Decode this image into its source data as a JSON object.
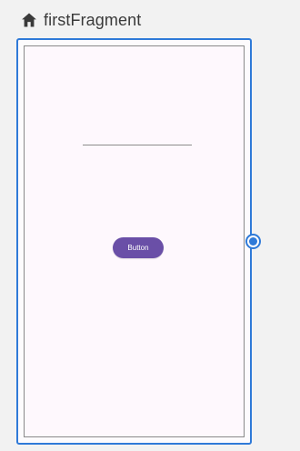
{
  "header": {
    "icon": "home-icon",
    "title": "firstFragment"
  },
  "fragment": {
    "button_label": "Button"
  }
}
